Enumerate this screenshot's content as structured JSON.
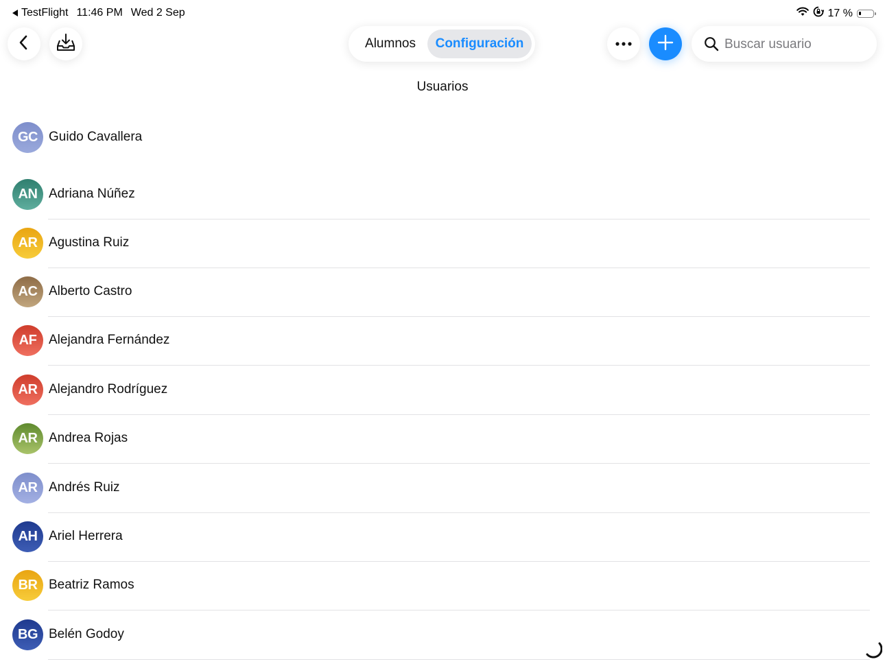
{
  "status_bar": {
    "back_app": "TestFlight",
    "time": "11:46 PM",
    "date": "Wed 2 Sep",
    "battery": "17 %",
    "battery_level": 0.17
  },
  "toolbar": {
    "segments": [
      "Alumnos",
      "Configuración"
    ],
    "selected_segment": "Configuración",
    "search_placeholder": "Buscar usuario",
    "search_value": ""
  },
  "page": {
    "title": "Usuarios"
  },
  "colors": {
    "accent": "#1a8cff",
    "segment_selected_bg": "#e6e7ea",
    "separator": "#e2e2e4"
  },
  "users": [
    {
      "initials": "GC",
      "name": "Guido Cavallera",
      "color": "#9aa9dc",
      "color_dark": "#7e8ecb"
    },
    {
      "initials": "AN",
      "name": "Adriana Núñez",
      "color": "#5fae9e",
      "color_dark": "#2f7f6f"
    },
    {
      "initials": "AR",
      "name": "Agustina Ruiz",
      "color": "#f7cc3a",
      "color_dark": "#e9a512"
    },
    {
      "initials": "AC",
      "name": "Alberto Castro",
      "color": "#c1a67e",
      "color_dark": "#8e6c47"
    },
    {
      "initials": "AF",
      "name": "Alejandra Fernández",
      "color": "#ef6f5f",
      "color_dark": "#cf3d2c"
    },
    {
      "initials": "AR",
      "name": "Alejandro Rodríguez",
      "color": "#ef6f5f",
      "color_dark": "#cf3d2c"
    },
    {
      "initials": "AR",
      "name": "Andrea Rojas",
      "color": "#a9c36a",
      "color_dark": "#5f8a2e"
    },
    {
      "initials": "AR",
      "name": "Andrés Ruiz",
      "color": "#a3b0e3",
      "color_dark": "#7e8ecb"
    },
    {
      "initials": "AH",
      "name": "Ariel Herrera",
      "color": "#3d5db5",
      "color_dark": "#1f3a8f"
    },
    {
      "initials": "BR",
      "name": "Beatriz Ramos",
      "color": "#f7cc3a",
      "color_dark": "#e9a512"
    },
    {
      "initials": "BG",
      "name": "Belén Godoy",
      "color": "#3d5db5",
      "color_dark": "#1f3a8f"
    }
  ]
}
